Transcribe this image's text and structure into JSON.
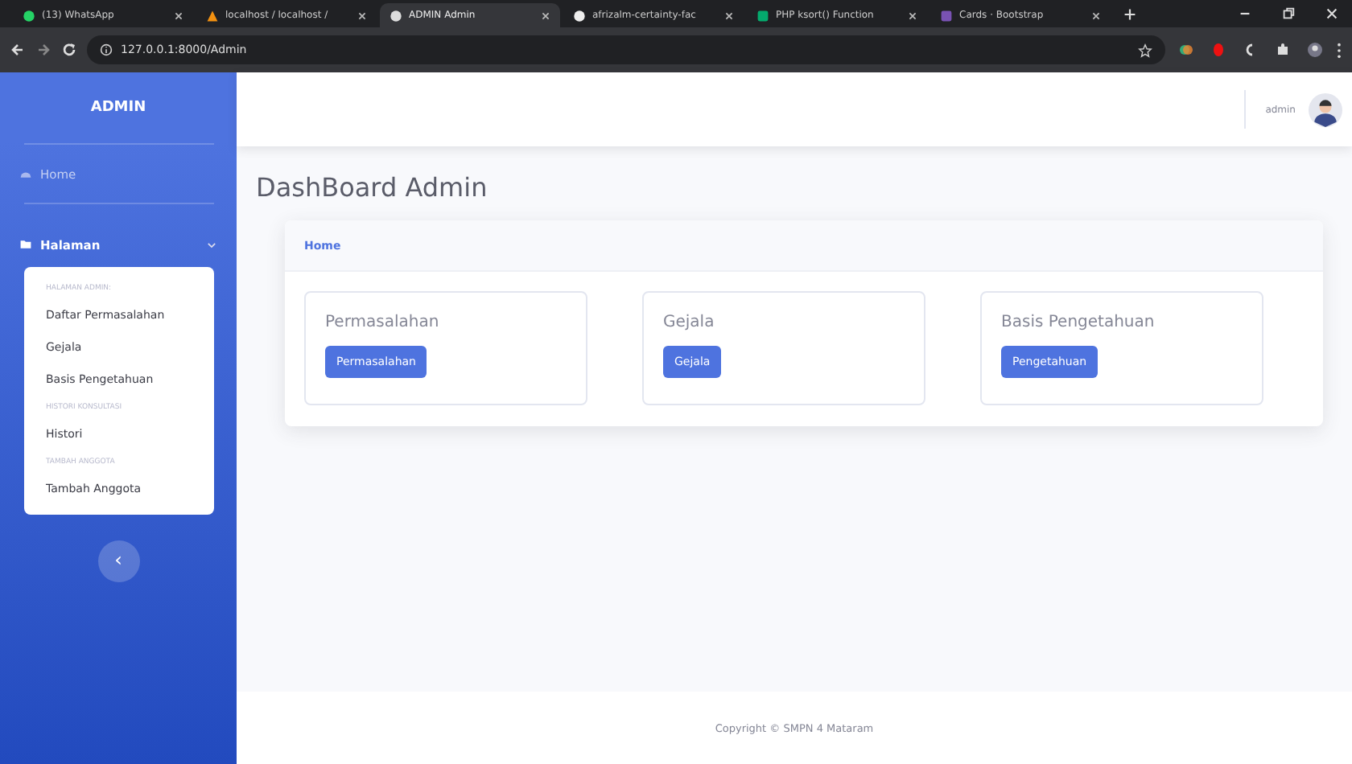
{
  "browser": {
    "tabs": [
      {
        "title": "(13) WhatsApp",
        "kind": "chat",
        "selected": false
      },
      {
        "title": "localhost / localhost /",
        "kind": "db",
        "selected": false
      },
      {
        "title": "ADMIN Admin",
        "kind": "globe",
        "selected": true
      },
      {
        "title": "afrizalm-certainty-fac",
        "kind": "github",
        "selected": false
      },
      {
        "title": "PHP ksort() Function",
        "kind": "w",
        "selected": false
      },
      {
        "title": "Cards · Bootstrap",
        "kind": "b",
        "selected": false
      }
    ],
    "url": "127.0.0.1:8000/Admin"
  },
  "sidebar": {
    "brand": "ADMIN",
    "home": "Home",
    "section": {
      "label": "Halaman",
      "expanded": true,
      "groups": [
        {
          "heading": "HALAMAN ADMIN:",
          "items": [
            "Daftar Permasalahan",
            "Gejala",
            "Basis Pengetahuan"
          ]
        },
        {
          "heading": "HISTORI KONSULTASI",
          "items": [
            "Histori"
          ]
        },
        {
          "heading": "TAMBAH ANGGOTA",
          "items": [
            "Tambah Anggota"
          ]
        }
      ]
    },
    "toggle": "‹"
  },
  "topbar": {
    "user": "admin"
  },
  "page_title": "DashBoard Admin",
  "card": {
    "header": "Home",
    "items": [
      {
        "title": "Permasalahan",
        "button": "Permasalahan"
      },
      {
        "title": "Gejala",
        "button": "Gejala"
      },
      {
        "title": "Basis Pengetahuan",
        "button": "Pengetahuan"
      }
    ]
  },
  "footer": "Copyright © SMPN 4 Mataram"
}
